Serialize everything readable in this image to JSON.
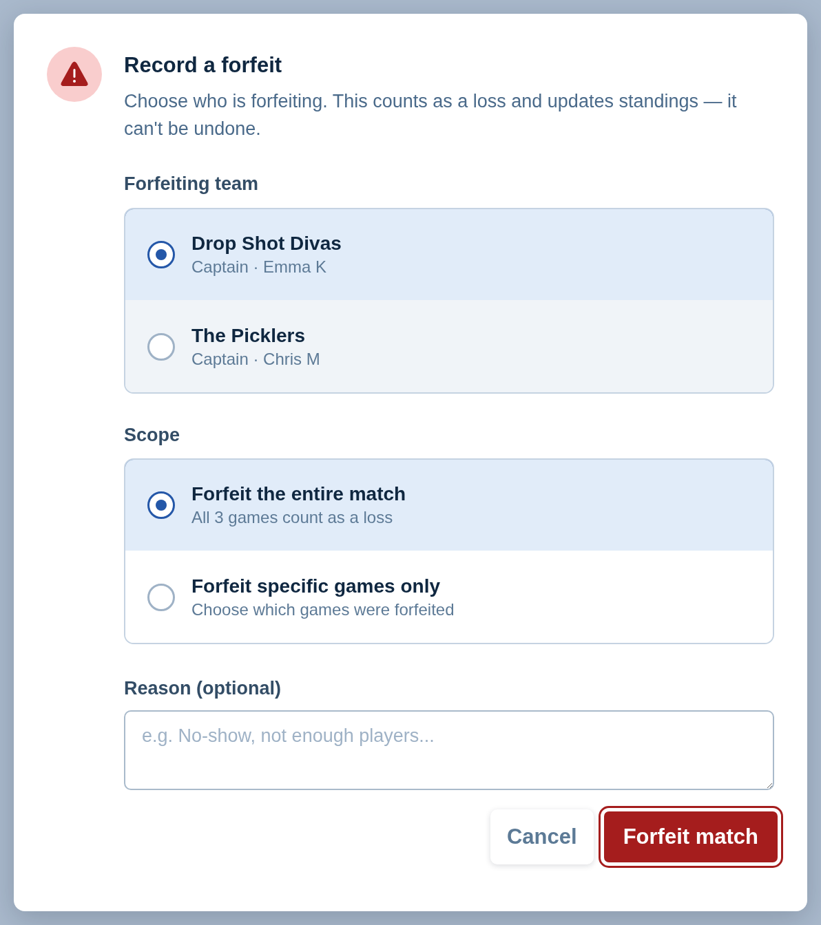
{
  "dialog": {
    "title": "Record a forfeit",
    "description": "Choose who is forfeiting. This counts as a loss and updates standings — it can't be undone."
  },
  "groups": [
    {
      "label": "Forfeiting team",
      "options": [
        {
          "title": "Drop Shot Divas",
          "subtitle": "Captain · Emma K",
          "selected": true,
          "hovered": false
        },
        {
          "title": "The Picklers",
          "subtitle": "Captain · Chris M",
          "selected": false,
          "hovered": true
        }
      ]
    },
    {
      "label": "Scope",
      "options": [
        {
          "title": "Forfeit the entire match",
          "subtitle": "All 3 games count as a loss",
          "selected": true,
          "hovered": false
        },
        {
          "title": "Forfeit specific games only",
          "subtitle": "Choose which games were forfeited",
          "selected": false,
          "hovered": false
        }
      ]
    }
  ],
  "reason": {
    "label": "Reason (optional)",
    "placeholder": "e.g. No-show, not enough players..."
  },
  "buttons": [
    {
      "kind": "secondary",
      "label": "Cancel",
      "focused": false
    },
    {
      "kind": "danger",
      "label": "Forfeit match",
      "focused": true
    }
  ]
}
